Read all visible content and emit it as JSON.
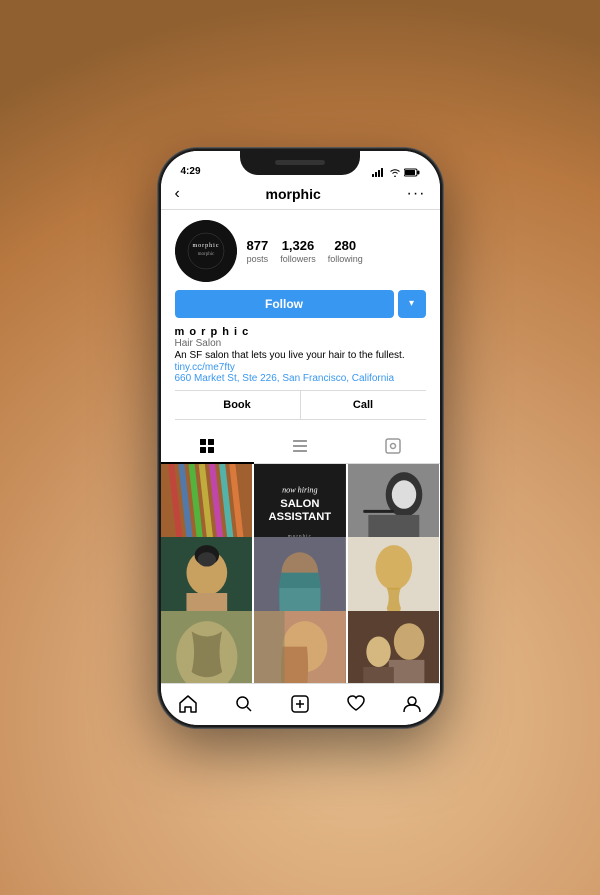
{
  "background": "#e8ddd0",
  "phone": {
    "status_bar": {
      "time": "4:29",
      "signal_icon": "signal",
      "wifi_icon": "wifi",
      "battery_icon": "battery"
    },
    "nav": {
      "back_icon": "‹",
      "title": "morphic",
      "more_icon": "···"
    },
    "profile": {
      "avatar_text": "morphic",
      "stats": [
        {
          "number": "877",
          "label": "posts"
        },
        {
          "number": "1,326",
          "label": "followers"
        },
        {
          "number": "280",
          "label": "following"
        }
      ],
      "follow_button": "Follow",
      "dropdown_icon": "▾",
      "bio": {
        "username": "m o r p h i c",
        "category": "Hair Salon",
        "description": "An SF salon that lets you live your hair to the fullest.",
        "link": "tiny.cc/me7fty",
        "address": "660 Market St, Ste 226, San Francisco, California"
      },
      "action_book": "Book",
      "action_call": "Call"
    },
    "tabs": {
      "grid_icon": "⊞",
      "list_icon": "≡",
      "tag_icon": "◻"
    },
    "grid_photos": [
      {
        "id": 1,
        "style": "p1",
        "label": "braids colorful"
      },
      {
        "id": 2,
        "style": "p2",
        "label": "now hiring salon assistant"
      },
      {
        "id": 3,
        "style": "p3",
        "label": "hair cut bw"
      },
      {
        "id": 4,
        "style": "p4",
        "label": "hair bun dark"
      },
      {
        "id": 5,
        "style": "p5",
        "label": "hair color teal"
      },
      {
        "id": 6,
        "style": "p6",
        "label": "blonde braid"
      },
      {
        "id": 7,
        "style": "p7",
        "label": "braid pattern"
      },
      {
        "id": 8,
        "style": "p8",
        "label": "braid profile"
      },
      {
        "id": 9,
        "style": "p9",
        "label": "stylist working"
      }
    ],
    "bottom_nav": [
      {
        "icon": "home",
        "label": "Home"
      },
      {
        "icon": "search",
        "label": "Search"
      },
      {
        "icon": "plus-square",
        "label": "Add"
      },
      {
        "icon": "heart",
        "label": "Activity"
      },
      {
        "icon": "profile",
        "label": "Profile"
      }
    ]
  }
}
